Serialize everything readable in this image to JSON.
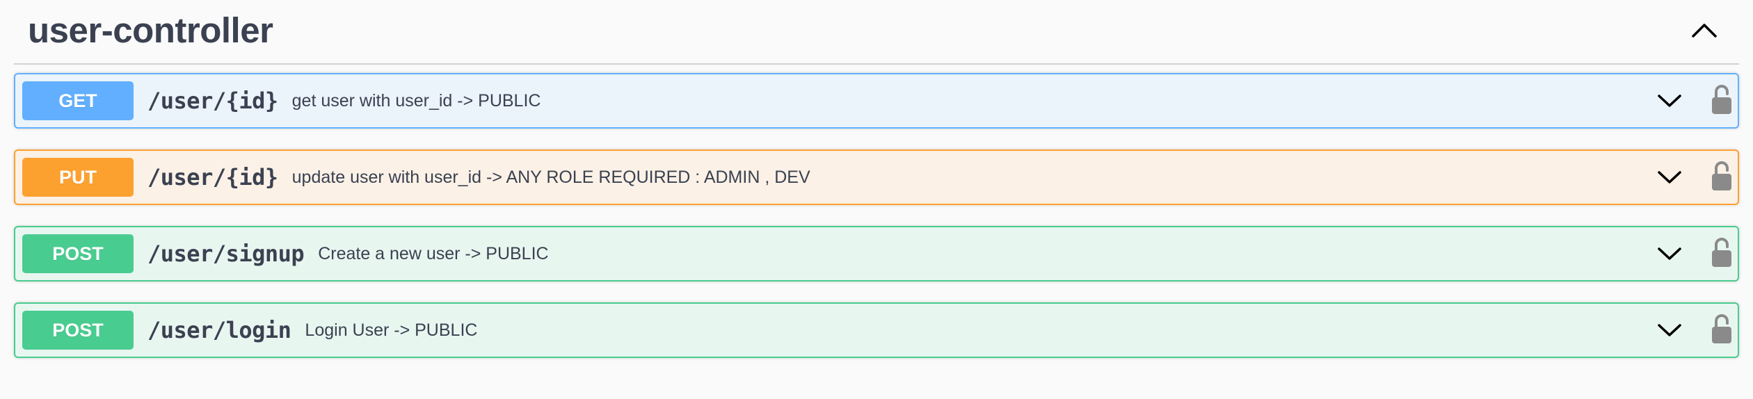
{
  "section": {
    "title": "user-controller",
    "collapse_icon": "chevron-up-icon"
  },
  "operations": [
    {
      "method": "GET",
      "path": "/user/{id}",
      "summary": "get user with user_id -> PUBLIC",
      "color": "#61affe",
      "background": "#ebf3fb"
    },
    {
      "method": "PUT",
      "path": "/user/{id}",
      "summary": "update user with user_id -> ANY ROLE REQUIRED : ADMIN , DEV",
      "color": "#fca130",
      "background": "#fbf1e6"
    },
    {
      "method": "POST",
      "path": "/user/signup",
      "summary": "Create a new user -> PUBLIC",
      "color": "#49cc90",
      "background": "#e8f6f0"
    },
    {
      "method": "POST",
      "path": "/user/login",
      "summary": "Login User -> PUBLIC",
      "color": "#49cc90",
      "background": "#e8f6f0"
    }
  ],
  "icons": {
    "expand": "chevron-down-icon",
    "auth": "unlocked-padlock-icon"
  }
}
